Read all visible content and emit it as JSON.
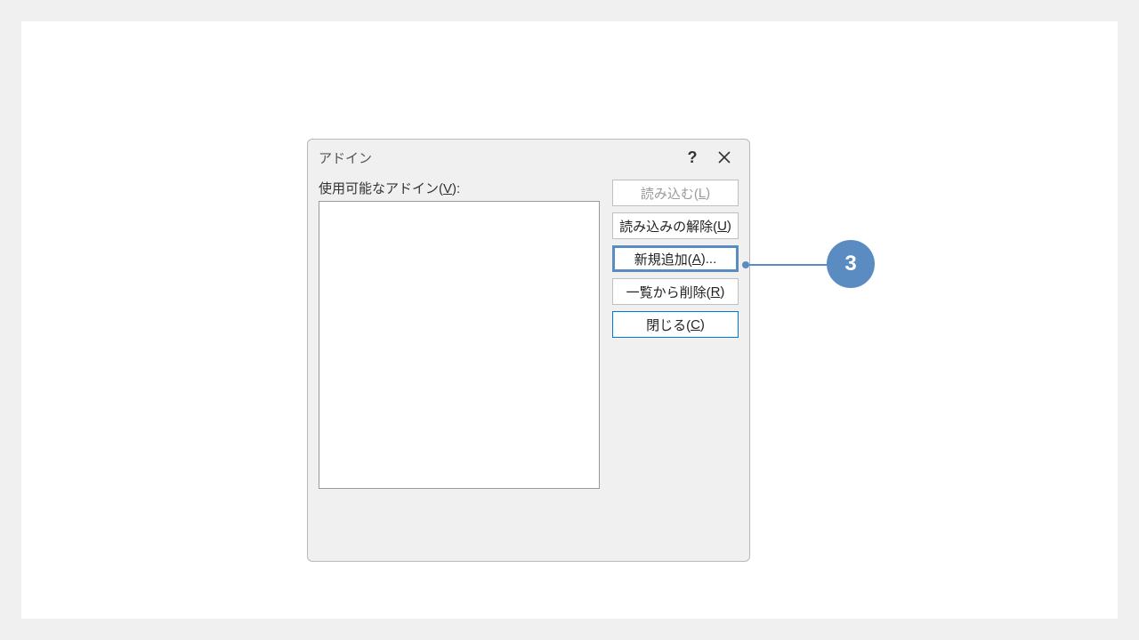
{
  "dialog": {
    "title": "アドイン",
    "help_symbol": "?",
    "label_prefix": "使用可能なアドイン(",
    "label_hotkey": "V",
    "label_suffix": "):",
    "buttons": {
      "load": {
        "prefix": "読み込む(",
        "hotkey": "L",
        "suffix": ")"
      },
      "unload": {
        "prefix": "読み込みの解除(",
        "hotkey": "U",
        "suffix": ")"
      },
      "add": {
        "prefix": "新規追加(",
        "hotkey": "A",
        "suffix": ")..."
      },
      "remove": {
        "prefix": "一覧から削除(",
        "hotkey": "R",
        "suffix": ")"
      },
      "close": {
        "prefix": "閉じる(",
        "hotkey": "C",
        "suffix": ")"
      }
    }
  },
  "callout": {
    "number": "3"
  }
}
